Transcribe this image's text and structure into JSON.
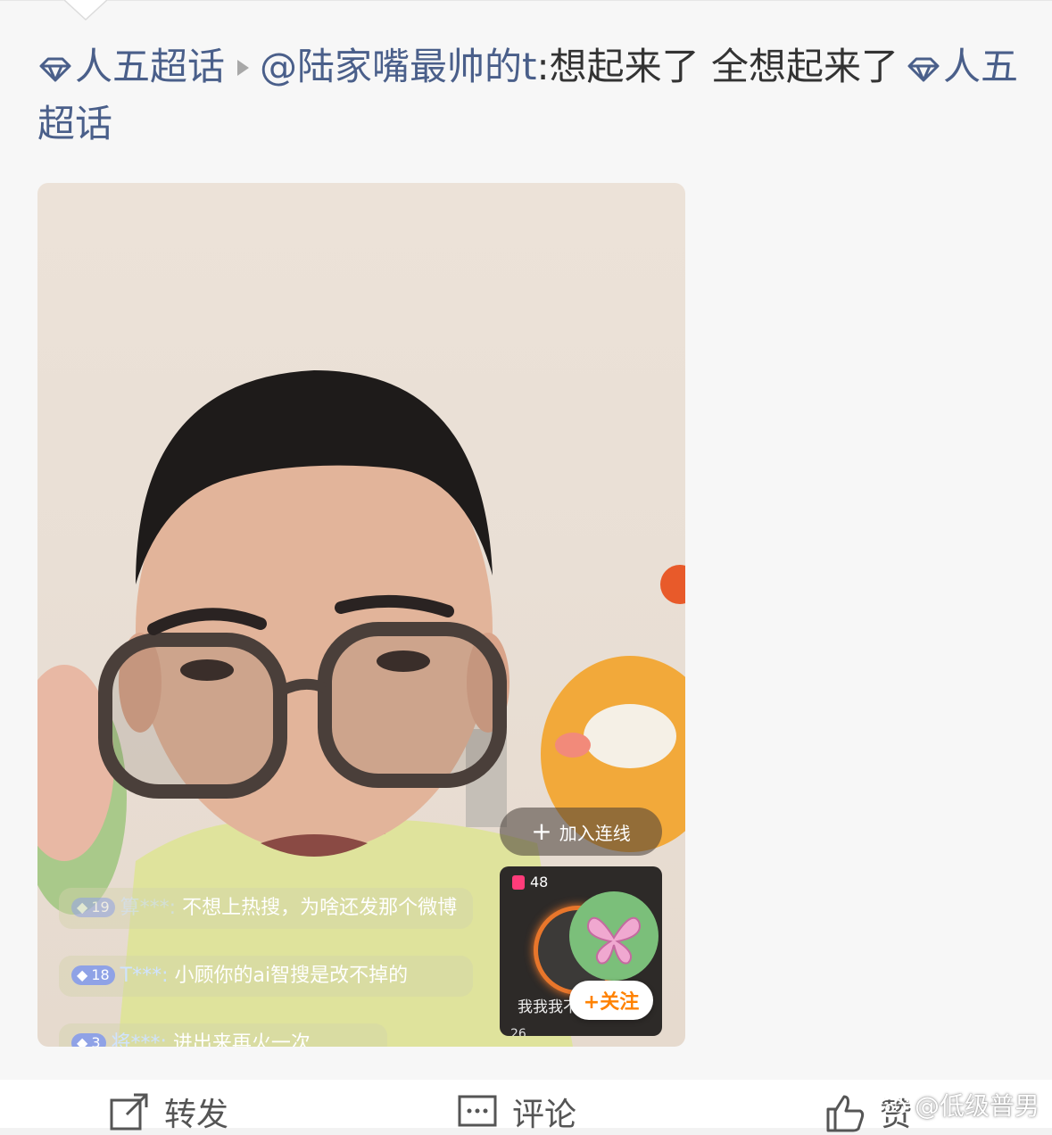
{
  "post": {
    "topic1": "人五超话",
    "mention": "@陆家嘴最帅的t",
    "body": ":想起来了 全想起来了",
    "topic2": "人五超话"
  },
  "video": {
    "connect_label": "加入连线",
    "mini_count": "48",
    "mini_caption": "我我我不是结结…",
    "mini_next_count": "26",
    "follow_label": "+关注",
    "comments": [
      {
        "level": "19",
        "user": "算***:",
        "text": "不想上热搜，为啥还发那个微博"
      },
      {
        "level": "18",
        "user": "T***:",
        "text": "小顾你的ai智搜是改不掉的"
      },
      {
        "level": "3",
        "user": "将***:",
        "text": "进出来再火一次"
      }
    ]
  },
  "actions": {
    "repost": "转发",
    "comment": "评论",
    "like": "赞"
  },
  "watermark": "@低级普男"
}
